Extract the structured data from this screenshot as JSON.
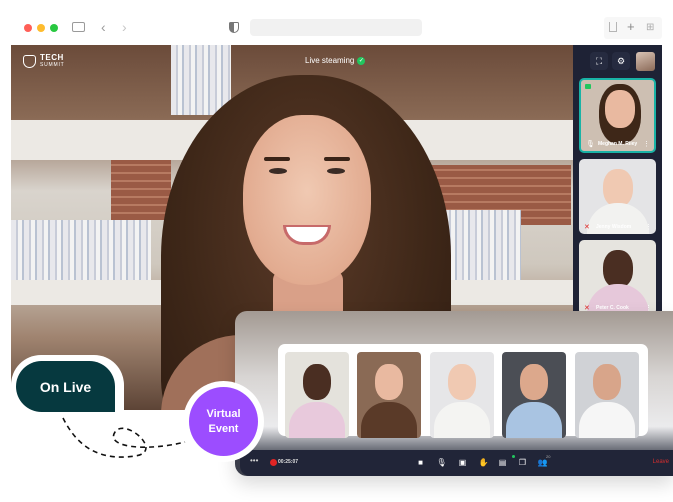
{
  "browser": {
    "traffic_lights": [
      "#ff5f57",
      "#febc2e",
      "#28c840"
    ],
    "icons": [
      "sidebar-toggle",
      "back",
      "forward",
      "privacy-shield",
      "share",
      "new-tab",
      "tab-overview"
    ]
  },
  "stream": {
    "brand_line1": "TECH",
    "brand_line2": "SUMMIT",
    "status": "Live steaming",
    "status_icon": "verified-check"
  },
  "sidebar": {
    "buttons": [
      "fullscreen",
      "settings"
    ],
    "participants": [
      {
        "name": "Meghan M. Riley",
        "mic": "on",
        "active": true
      },
      {
        "name": "Jenny Wisdom",
        "mic": "muted",
        "active": false
      },
      {
        "name": "Peter C. Cook",
        "mic": "muted",
        "active": false
      }
    ]
  },
  "gallery": {
    "count": 5
  },
  "controls": {
    "more": "•••",
    "timer": "00:25:07",
    "buttons": [
      "camera",
      "microphone",
      "screen-share",
      "raise-hand",
      "chat",
      "copy",
      "participants"
    ],
    "participants_badge": "20",
    "leave": "Leave"
  },
  "badges": {
    "on_live": "On Live",
    "virtual_event": "Virtual Event"
  },
  "colors": {
    "accent_teal": "#19b3a6",
    "on_live_bg": "#06393f",
    "virtual_bg": "#9c4dff",
    "dark_panel": "#1e2235",
    "live_green": "#22c55e",
    "leave_red": "#d42e2e"
  }
}
